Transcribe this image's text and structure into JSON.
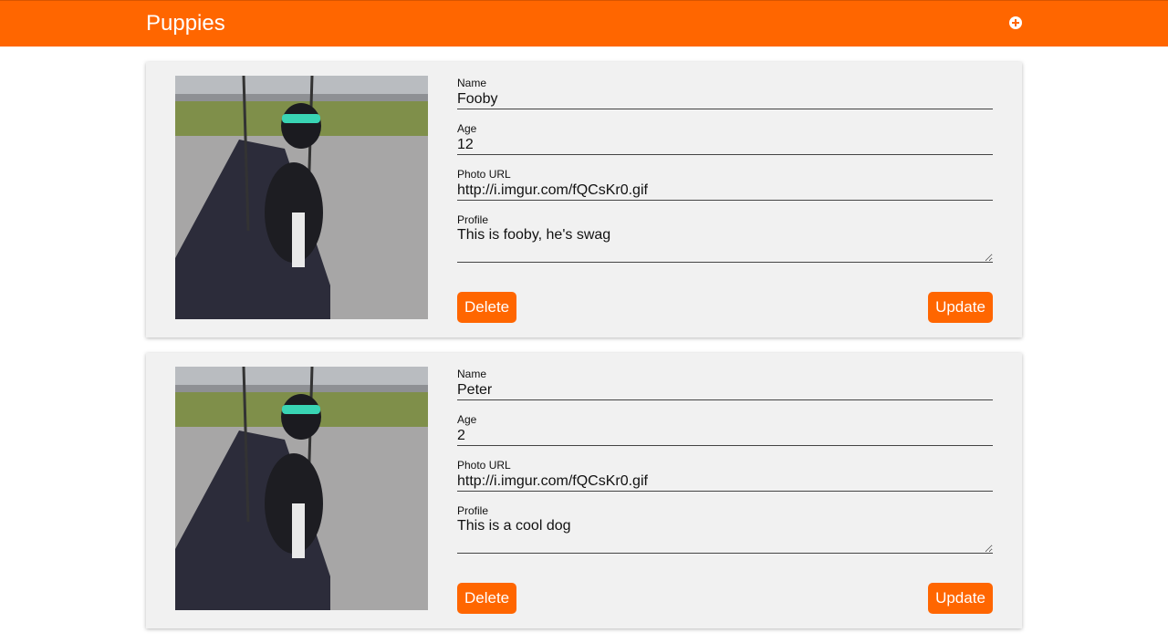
{
  "app": {
    "title": "Puppies",
    "add_icon": "plus-circle-icon"
  },
  "colors": {
    "brand": "#ff6600",
    "card_bg": "#f1f1f1"
  },
  "labels": {
    "name": "Name",
    "age": "Age",
    "photo_url": "Photo URL",
    "profile": "Profile",
    "delete": "Delete",
    "update": "Update"
  },
  "puppies": [
    {
      "name": "Fooby",
      "age": "12",
      "photo_url": "http://i.imgur.com/fQCsKr0.gif",
      "profile": "This is fooby, he's swag"
    },
    {
      "name": "Peter",
      "age": "2",
      "photo_url": "http://i.imgur.com/fQCsKr0.gif",
      "profile": "This is a cool dog"
    }
  ]
}
